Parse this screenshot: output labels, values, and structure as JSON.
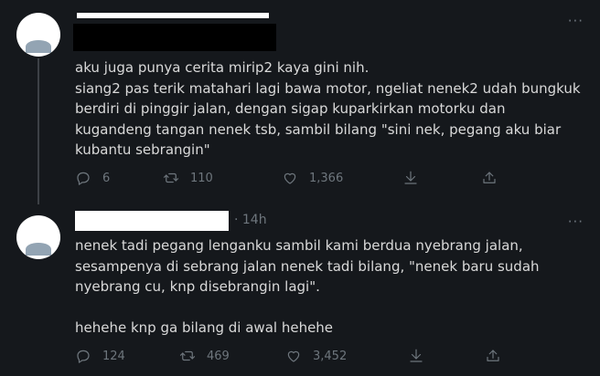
{
  "tweet1": {
    "text": "aku juga punya cerita mirip2 kaya gini nih.\nsiang2 pas terik matahari lagi bawa motor, ngeliat nenek2 udah bungkuk berdiri di pinggir jalan, dengan sigap kuparkirkan motorku dan kugandeng tangan nenek tsb, sambil bilang \"sini nek, pegang aku biar kubantu sebrangin\"",
    "replies": "6",
    "retweets": "110",
    "likes": "1,366",
    "more": "···"
  },
  "tweet2": {
    "time": "· 14h",
    "text": "nenek tadi pegang lenganku sambil kami berdua nyebrang jalan, sesampenya di sebrang jalan nenek tadi bilang, \"nenek baru sudah nyebrang cu, knp disebrangin lagi\".\n\nhehehe knp ga bilang di awal hehehe",
    "replies": "124",
    "retweets": "469",
    "likes": "3,452",
    "more": "···"
  },
  "icons": [
    "reply-icon",
    "retweet-icon",
    "like-icon",
    "download-icon",
    "share-icon"
  ],
  "colors": {
    "background": "#15181c",
    "text": "#d9d9d9",
    "muted": "#6e767d",
    "thread_line": "#3d4146"
  }
}
